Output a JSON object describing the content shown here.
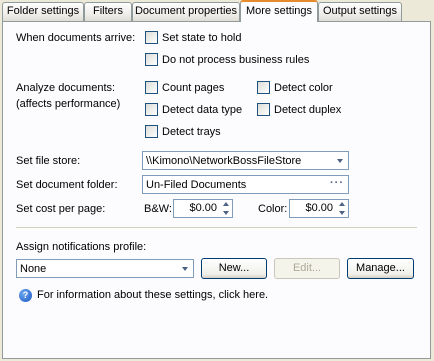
{
  "tabs": [
    {
      "label": "Folder settings"
    },
    {
      "label": "Filters"
    },
    {
      "label": "Document properties"
    },
    {
      "label": "More settings"
    },
    {
      "label": "Output settings"
    }
  ],
  "arrive": {
    "label": "When documents arrive:",
    "set_state": "Set state to hold",
    "no_rules": "Do not process business rules"
  },
  "analyze": {
    "label1": "Analyze documents:",
    "label2": "(affects performance)",
    "count_pages": "Count pages",
    "detect_color": "Detect color",
    "detect_data_type": "Detect data type",
    "detect_duplex": "Detect duplex",
    "detect_trays": "Detect trays"
  },
  "file_store": {
    "label": "Set file store:",
    "value": "\\\\Kimono\\NetworkBossFileStore"
  },
  "doc_folder": {
    "label": "Set document folder:",
    "value": "Un-Filed Documents",
    "ellipsis": "···"
  },
  "cost": {
    "label": "Set cost per page:",
    "bw_label": "B&W:",
    "bw_value": "$0.00",
    "color_label": "Color:",
    "color_value": "$0.00"
  },
  "notifications": {
    "label": "Assign notifications profile:",
    "value": "None",
    "new_btn": "New...",
    "edit_btn": "Edit...",
    "manage_btn": "Manage..."
  },
  "help": {
    "icon": "?",
    "text": "For information about these settings, click here."
  }
}
